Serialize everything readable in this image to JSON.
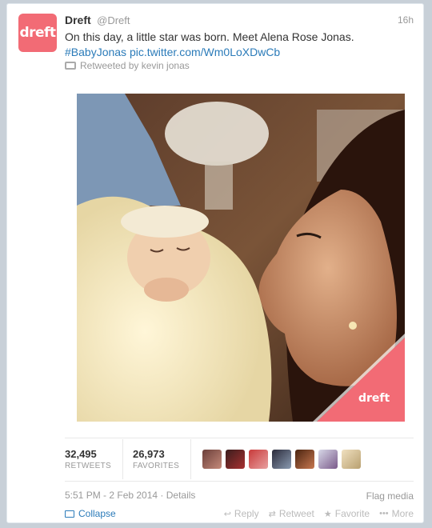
{
  "tweet": {
    "avatar_text": "dreft",
    "name": "Dreft",
    "handle": "@Dreft",
    "time": "16h",
    "text": "On this day, a little star was born.  Meet Alena Rose Jonas.",
    "hashtag": "#BabyJonas",
    "link": "pic.twitter.com/Wm0LoXDwCb",
    "retweeted_by": "Retweeted by kevin jonas"
  },
  "photo": {
    "watermark": "dreft",
    "brand_color": "#f26b75"
  },
  "stats": {
    "retweets_count": "32,495",
    "retweets_label": "RETWEETS",
    "favorites_count": "26,973",
    "favorites_label": "FAVORITES"
  },
  "details": {
    "timestamp": "5:51 PM - 2 Feb 2014 · Details",
    "flag": "Flag media"
  },
  "actions": {
    "collapse": "Collapse",
    "reply": "Reply",
    "retweet": "Retweet",
    "favorite": "Favorite",
    "more": "More"
  },
  "colors": {
    "link": "#2b7bb9",
    "muted": "#999999",
    "brand": "#f26b75"
  }
}
